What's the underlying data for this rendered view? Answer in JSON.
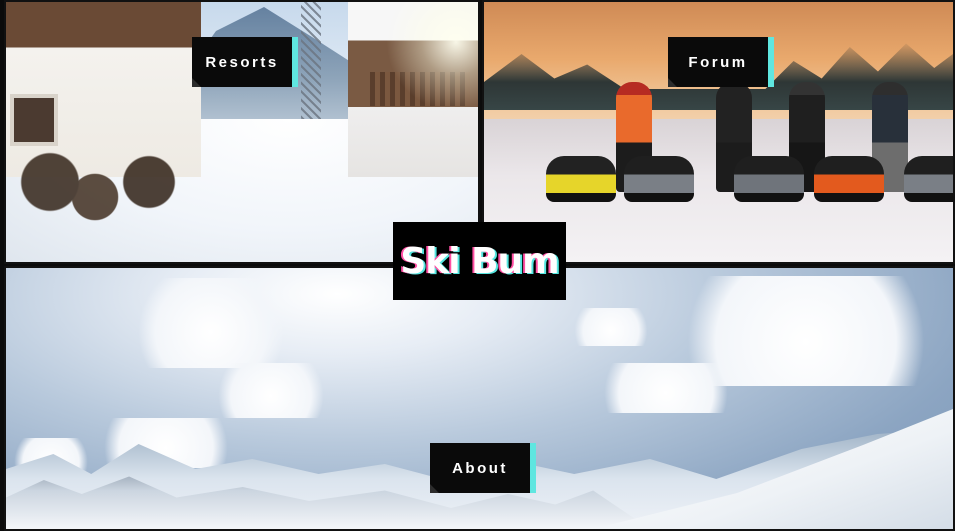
{
  "logo": {
    "text": "Ski Bum"
  },
  "nav": {
    "resorts_label": "Resorts",
    "forum_label": "Forum",
    "about_label": "About"
  },
  "colors": {
    "label_bg": "#0a0a0a",
    "accent_cyan": "#5fe6e0",
    "accent_pink": "#ff4fa3",
    "logo_bg": "#000000",
    "text": "#ffffff"
  }
}
